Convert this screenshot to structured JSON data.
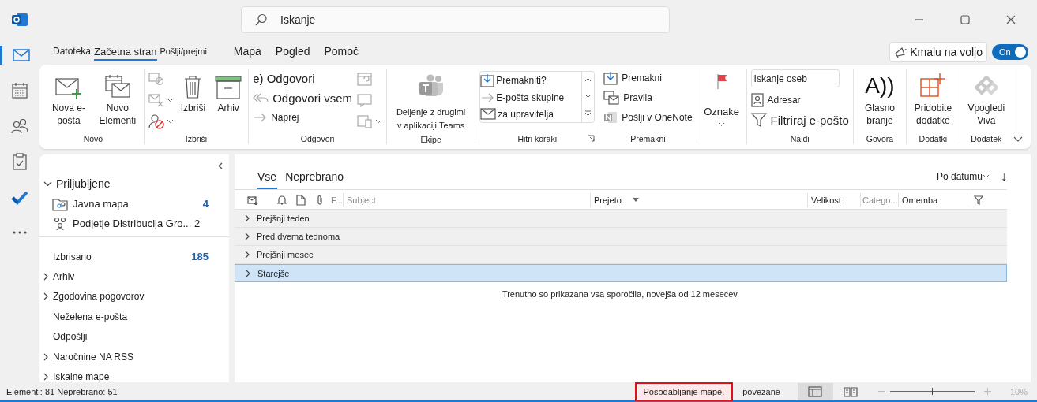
{
  "search": {
    "placeholder": "Iskanje"
  },
  "nav_items": [
    {
      "kind": "mail",
      "selected": true
    },
    {
      "kind": "calendar",
      "selected": false
    },
    {
      "kind": "people",
      "selected": false
    },
    {
      "kind": "tasks",
      "selected": false
    },
    {
      "kind": "todo",
      "selected": false
    },
    {
      "kind": "more",
      "selected": false
    }
  ],
  "menu_tabs": [
    {
      "label": "Datoteka",
      "selected": false
    },
    {
      "label": "Začetna stran",
      "selected": true
    },
    {
      "label": "Pošlji/prejmi",
      "selected": false
    },
    {
      "label": "Mapa",
      "selected": false
    },
    {
      "label": "Pogled",
      "selected": false
    },
    {
      "label": "Pomoč",
      "selected": false
    }
  ],
  "coming_soon": {
    "label": "Kmalu na voljo"
  },
  "toggle": {
    "label": "On",
    "on": true
  },
  "ribbon": {
    "groups": [
      {
        "label": "Novo",
        "columns": [
          [
            {
              "kind": "large",
              "label": "Nova e-pošta"
            }
          ],
          [
            {
              "kind": "large",
              "label": "Novo Elementi"
            }
          ]
        ]
      },
      {
        "label": "Izbriši",
        "columns": [
          [
            {
              "kind": "icon",
              "disabled": true,
              "dropdown": false
            },
            {
              "kind": "icon",
              "disabled": true,
              "dropdown": true
            },
            {
              "kind": "icon",
              "disabled": false,
              "dropdown": true
            }
          ],
          [
            {
              "kind": "large",
              "label": "Izbriši"
            }
          ],
          [
            {
              "kind": "large",
              "label": "Arhiv"
            }
          ]
        ]
      },
      {
        "label": "Odgovori",
        "columns": [
          [
            {
              "kind": "medium",
              "label": "e) Odgovori"
            },
            {
              "kind": "medium",
              "label": "Odgovori vsem"
            },
            {
              "kind": "small",
              "label": "Naprej"
            }
          ],
          [
            {
              "kind": "icon",
              "disabled": true,
              "dropdown": false
            },
            {
              "kind": "icon",
              "disabled": true,
              "dropdown": false
            },
            {
              "kind": "icon",
              "disabled": true,
              "dropdown": true
            }
          ]
        ]
      },
      {
        "label": "Ekipe",
        "columns": [
          [
            {
              "kind": "wide",
              "label": "Deljenje z drugimi v aplikaciji Teams"
            }
          ]
        ]
      },
      {
        "label": "Hitri koraki",
        "columns": [
          [
            {
              "kind": "gallery",
              "items": [
                "Premakniti?",
                "E-pošta skupine",
                "za upravitelja"
              ]
            }
          ]
        ]
      },
      {
        "label": "Premakni",
        "columns": [
          [
            {
              "kind": "small",
              "label": "Premakni"
            },
            {
              "kind": "small",
              "label": "Pravila"
            },
            {
              "kind": "small",
              "label": "Pošlji v OneNote"
            }
          ]
        ]
      },
      {
        "columns": [
          [
            {
              "kind": "flag",
              "label": "Oznake"
            }
          ]
        ]
      },
      {
        "label": "Najdi",
        "columns": [
          [
            {
              "kind": "field",
              "placeholder": "Iskanje oseb"
            },
            {
              "kind": "small",
              "label": "Adresar"
            },
            {
              "kind": "medium",
              "label": "Filtriraj e-pošto"
            }
          ]
        ]
      },
      {
        "label": "Govora",
        "columns": [
          [
            {
              "kind": "large",
              "glyph": "A))",
              "label": "Glasno branje"
            }
          ]
        ]
      },
      {
        "label": "Dodatki",
        "columns": [
          [
            {
              "kind": "large",
              "label": "Pridobite dodatke"
            }
          ]
        ]
      },
      {
        "label": "Dodatek",
        "columns": [
          [
            {
              "kind": "large",
              "label": "Vpogledi Viva"
            }
          ]
        ]
      }
    ]
  },
  "folders": {
    "favorites": {
      "label": "Priljubljene",
      "expanded": true,
      "items": [
        {
          "label": "Javna mapa",
          "count": "4"
        },
        {
          "label": "Podjetje Distribucija Gro... 2"
        }
      ]
    },
    "items": [
      {
        "label": "Izbrisano",
        "count": "185",
        "expandable": false
      },
      {
        "label": "Arhiv",
        "expandable": true
      },
      {
        "label": "Zgodovina pogovorov",
        "expandable": true
      },
      {
        "label": "Neželena e-pošta",
        "expandable": false
      },
      {
        "label": "Odpošlji",
        "expandable": false
      },
      {
        "label": "Naročnine NA RSS",
        "expandable": true
      },
      {
        "label": "Iskalne mape",
        "expandable": true
      }
    ]
  },
  "message_list": {
    "tabs": [
      {
        "label": "Vse",
        "selected": true
      },
      {
        "label": "Neprebrano",
        "selected": false
      }
    ],
    "sort": {
      "label": "Po datumu",
      "direction": "↓"
    },
    "columns": [
      {
        "kind": "icon"
      },
      {
        "kind": "icon"
      },
      {
        "kind": "icon"
      },
      {
        "kind": "icon"
      },
      {
        "kind": "text",
        "label": "F...",
        "dimmed": true
      },
      {
        "kind": "text",
        "label": "Subject",
        "dimmed": true
      },
      {
        "kind": "text",
        "label": "Prejeto",
        "dimmed": false,
        "sorted": true
      },
      {
        "kind": "text",
        "label": "Velikost",
        "dimmed": false
      },
      {
        "kind": "text",
        "label": "Catego...",
        "dimmed": true
      },
      {
        "kind": "text",
        "label": "Omemba",
        "dimmed": false
      },
      {
        "kind": "filter"
      }
    ],
    "groups": [
      {
        "label": "Prejšnji teden",
        "selected": false
      },
      {
        "label": "Pred dvema tednoma",
        "selected": false
      },
      {
        "label": "Prejšnji mesec",
        "selected": false
      },
      {
        "label": "Starejše",
        "selected": true
      }
    ],
    "info": "Trenutno so prikazana vsa sporočila, novejša od 12 mesecev."
  },
  "status_bar": {
    "counts": "Elementi: 81 Neprebrano: 51",
    "update": {
      "label": "Posodabljanje mape.",
      "highlighted": true
    },
    "connection": "povezane",
    "views": [
      {
        "kind": "normal",
        "selected": true
      },
      {
        "kind": "reading",
        "selected": false
      }
    ],
    "zoom": {
      "level": 0.5,
      "reading": "10%"
    }
  }
}
